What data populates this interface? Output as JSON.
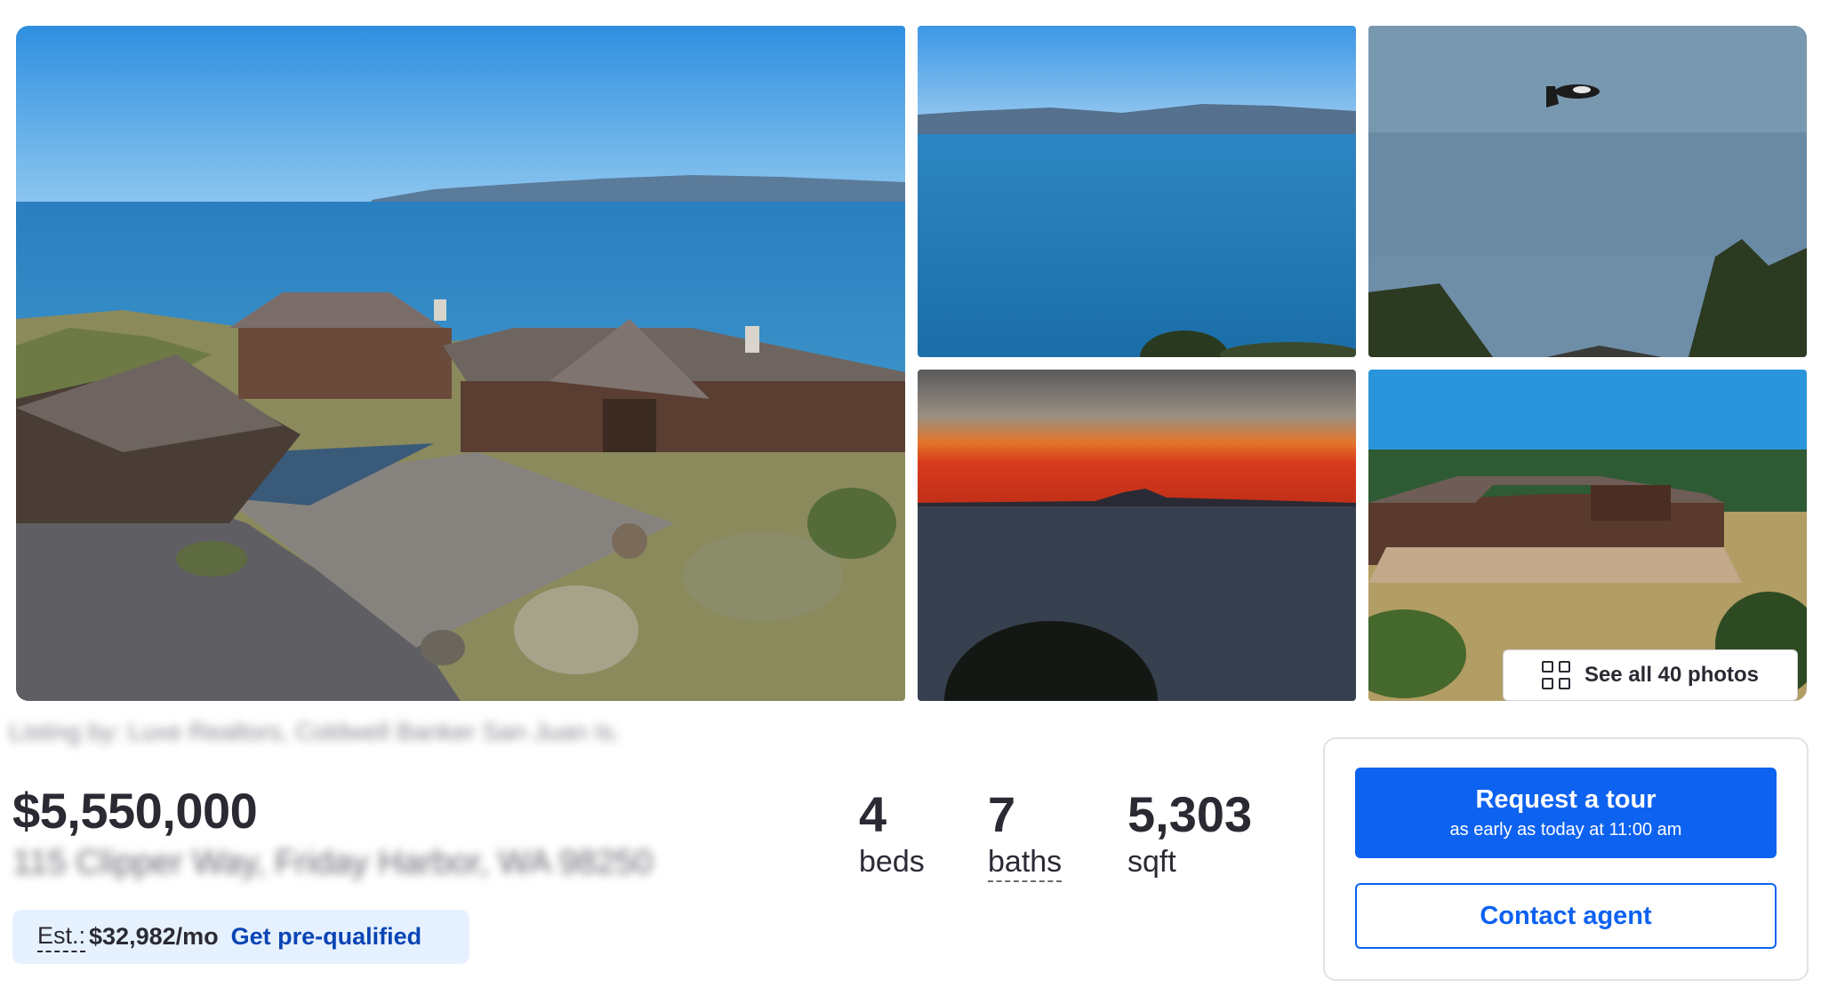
{
  "gallery": {
    "photos": [
      {
        "name": "aerial view of waterfront estate"
      },
      {
        "name": "ocean and mountain view"
      },
      {
        "name": "orcas swimming"
      },
      {
        "name": "sunset over water with mountain"
      },
      {
        "name": "aerial view of house and deck"
      }
    ],
    "see_all_label": "See all 40 photos"
  },
  "listing": {
    "attribution": "Listing by: Luxe Realtors, Coldwell Banker San Juan Is.",
    "price": "$5,550,000",
    "address": "115 Clipper Way, Friday Harbor, WA 98250"
  },
  "estimate": {
    "label": "Est.:",
    "amount": "$32,982/mo",
    "prequal_label": "Get pre-qualified"
  },
  "stats": {
    "beds_value": "4",
    "beds_label": "beds",
    "baths_value": "7",
    "baths_label": "baths",
    "sqft_value": "5,303",
    "sqft_label": "sqft"
  },
  "cta": {
    "tour_label": "Request a tour",
    "tour_sub": "as early as today at 11:00 am",
    "contact_label": "Contact agent"
  },
  "colors": {
    "primary": "#0d62f0",
    "prequal_bg": "#e6f1ff",
    "text": "#2a2a33"
  }
}
